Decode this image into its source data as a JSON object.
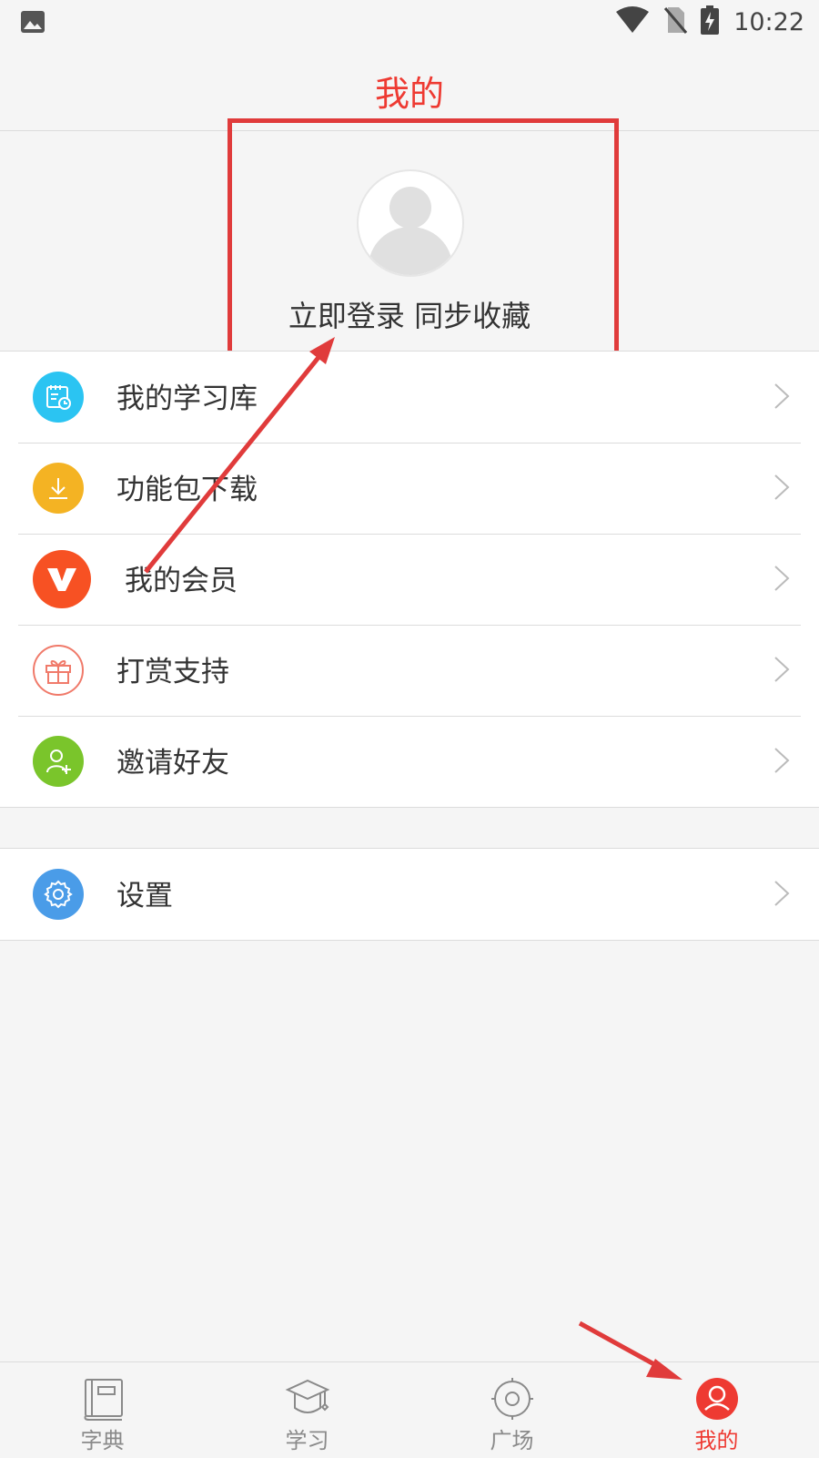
{
  "status_bar": {
    "time": "10:22"
  },
  "header": {
    "title": "我的"
  },
  "profile": {
    "login_prompt": "立即登录 同步收藏"
  },
  "menu": {
    "group1": [
      {
        "label": "我的学习库",
        "icon": "study-library-icon",
        "color": "#2bc4f2"
      },
      {
        "label": "功能包下载",
        "icon": "download-icon",
        "color": "#f4b323"
      },
      {
        "label": "我的会员",
        "icon": "vip-icon",
        "color": "#f75123"
      },
      {
        "label": "打赏支持",
        "icon": "gift-icon",
        "color": "#f07a6a"
      },
      {
        "label": "邀请好友",
        "icon": "add-friend-icon",
        "color": "#7ac52b"
      }
    ],
    "group2": [
      {
        "label": "设置",
        "icon": "gear-icon",
        "color": "#4a9ce8"
      }
    ]
  },
  "tabs": [
    {
      "label": "字典",
      "icon": "dictionary-icon"
    },
    {
      "label": "学习",
      "icon": "graduation-cap-icon"
    },
    {
      "label": "广场",
      "icon": "plaza-icon"
    },
    {
      "label": "我的",
      "icon": "profile-icon",
      "active": true
    }
  ],
  "colors": {
    "accent": "#ee3a32",
    "annotation": "#e03b3b"
  }
}
